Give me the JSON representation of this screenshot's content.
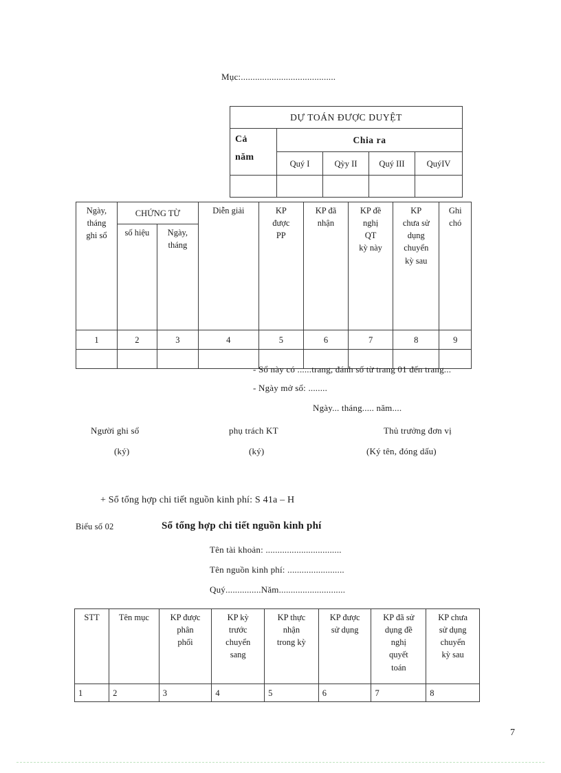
{
  "page": {
    "number": "7"
  },
  "section_top": {
    "muc_line": "Mục:........................................"
  },
  "budget_table": {
    "title": "DỰ TOÁN ĐƯỢC DUYỆT",
    "col_ca_nam": "Cả\nnăm",
    "col_ca_nam_line1": "Cả",
    "col_ca_nam_line2": "năm",
    "group_header": "Chia ra",
    "quarters": [
      "Quý I",
      "Qỳy II",
      "Quý III",
      "QuýIV"
    ]
  },
  "ledger_table": {
    "headers": {
      "date_record": [
        "Ngày,",
        "tháng",
        "ghi sổ"
      ],
      "voucher_group": "CHỨNG TỪ",
      "voucher_number": [
        "số hiệu"
      ],
      "voucher_date": [
        "Ngày,",
        "tháng"
      ],
      "description": [
        "Diễn giải"
      ],
      "kp_allocated": [
        "KP",
        "được",
        "PP"
      ],
      "kp_received": [
        "KP đã",
        "nhận"
      ],
      "kp_proposed": [
        "KP đề",
        "nghị",
        "QT",
        "kỳ này"
      ],
      "kp_unused": [
        "KP",
        "chưa sử",
        "dụng",
        "chuyển",
        "kỳ sau"
      ],
      "note": [
        "Ghi",
        "chó"
      ]
    },
    "number_row": [
      "1",
      "2",
      "3",
      "4",
      "5",
      "6",
      "7",
      "8",
      "9"
    ]
  },
  "notes": {
    "line1": "- Sổ này có ......trang, đánh số từ trang 01 đến trang...",
    "line2": "- Ngày mở sổ: ........",
    "date_line": "Ngày... tháng..... năm...."
  },
  "signatures": {
    "recorder": {
      "title": "Người ghi sổ",
      "sub": "(ký)"
    },
    "accountant": {
      "title": "phụ trách KT",
      "sub": "(ký)"
    },
    "director": {
      "title": "Thủ trưởng đơn vị",
      "sub": "(Ký tên, đóng dấu)"
    }
  },
  "section_bottom": {
    "intro": "+ Sổ tổng hợp chi tiết nguồn kinh phí: S 41a – H",
    "form_label": "Biểu số 02",
    "form_title": "Sổ tổng hợp chi tiết nguồn kinh phí",
    "field_account": "Tên tài khoản: ................................",
    "field_source": "Tên nguồn  kinh  phí: ........................",
    "field_quarter_year": "Quý...............Năm............................"
  },
  "summary_table": {
    "headers": {
      "stt": [
        "STT"
      ],
      "item_name": [
        "Tên mục"
      ],
      "kp_allocated": [
        "KP được",
        "phân",
        "phối"
      ],
      "kp_carried_in": [
        "KP kỳ",
        "trước",
        "chuyển",
        "sang"
      ],
      "kp_received": [
        "KP thực",
        "nhận",
        "trong kỳ"
      ],
      "kp_usable": [
        "KP được",
        "sử dụng"
      ],
      "kp_used": [
        "KP đã sử",
        "dụng  đề",
        "nghị",
        "quyết",
        "toán"
      ],
      "kp_unused": [
        "KP chưa",
        "sử dụng",
        "chuyển",
        "kỳ sau"
      ]
    },
    "number_row": [
      "1",
      "2",
      "3",
      "4",
      "5",
      "6",
      "7",
      "8"
    ]
  }
}
